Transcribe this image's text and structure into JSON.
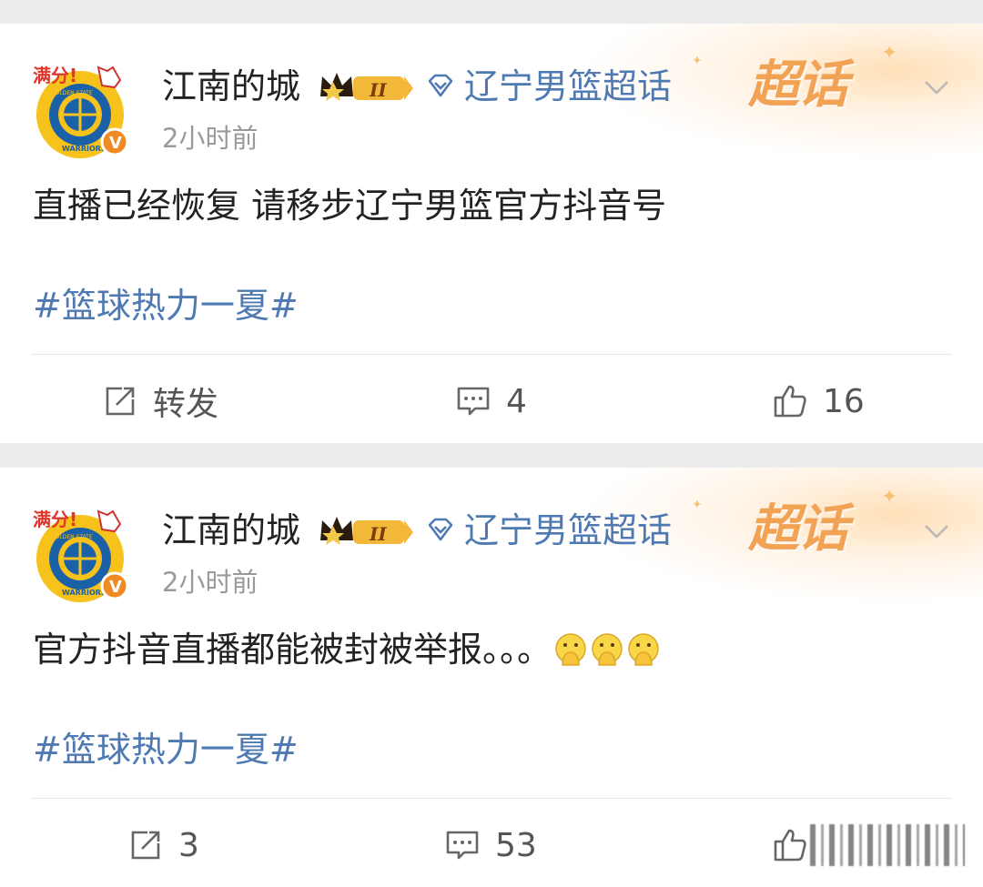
{
  "posts": [
    {
      "user": {
        "name": "江南的城",
        "badge_level": "II"
      },
      "topic": {
        "label": "辽宁男篮超话",
        "banner": "超话"
      },
      "time": "2小时前",
      "content": "直播已经恢复  请移步辽宁男篮官方抖音号",
      "emojis": [],
      "hashtag": "#篮球热力一夏#",
      "actions": {
        "repost": "转发",
        "comment": "4",
        "like": "16"
      }
    },
    {
      "user": {
        "name": "江南的城",
        "badge_level": "II"
      },
      "topic": {
        "label": "辽宁男篮超话",
        "banner": "超话"
      },
      "time": "2小时前",
      "content": "官方抖音直播都能被封被举报。。。",
      "emojis": [
        "clasped-hands-emoji",
        "clasped-hands-emoji",
        "clasped-hands-emoji"
      ],
      "hashtag": "#篮球热力一夏#",
      "actions": {
        "repost": "3",
        "comment": "53",
        "like": ""
      }
    }
  ],
  "avatar": {
    "top_text": "满分!",
    "ring_text_top": "GOLDEN STATE",
    "ring_text_bottom": "WARRIORS",
    "verified_mark": "V"
  },
  "colors": {
    "link": "#4e79b2",
    "banner": "#f2a254",
    "avatar_yellow": "#f6c21b",
    "avatar_blue": "#1a61a8",
    "verified": "#f08a24"
  }
}
